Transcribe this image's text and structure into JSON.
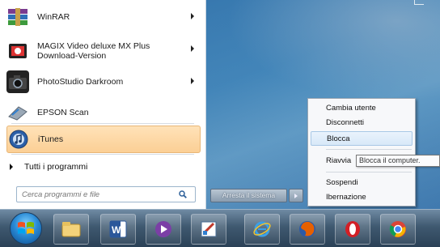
{
  "start_menu": {
    "programs": [
      {
        "label_line1": "WinRAR",
        "label_line2": "",
        "icon": "winrar-icon",
        "has_submenu": true
      },
      {
        "label_line1": "MAGIX Video deluxe MX Plus",
        "label_line2": "Download-Version",
        "icon": "magix-icon",
        "has_submenu": true
      },
      {
        "label_line1": "PhotoStudio Darkroom",
        "label_line2": "",
        "icon": "camera-icon",
        "has_submenu": true
      },
      {
        "label_line1": "EPSON Scan",
        "label_line2": "",
        "icon": "scanner-icon",
        "has_submenu": false
      },
      {
        "label_line1": "iTunes",
        "label_line2": "",
        "icon": "itunes-icon",
        "has_submenu": false
      }
    ],
    "all_programs": "Tutti i programmi",
    "search_placeholder": "Cerca programmi e file",
    "shutdown_label": "Arresta il sistema"
  },
  "context_menu": {
    "items": [
      "Cambia utente",
      "Disconnetti",
      "Blocca",
      "Riavvia",
      "Sospendi",
      "Ibernazione"
    ],
    "highlighted": "Blocca"
  },
  "tooltip": "Blocca il computer.",
  "taskbar": {
    "pinned": [
      "explorer-icon",
      "word-icon",
      "media-icon",
      "paint-icon",
      "ie-icon",
      "firefox-icon",
      "opera-icon",
      "chrome-icon"
    ]
  },
  "colors": {
    "highlight": "#fbcf95",
    "ctx_highlight": "#d7e8f8",
    "taskbar": "#3f5970"
  }
}
